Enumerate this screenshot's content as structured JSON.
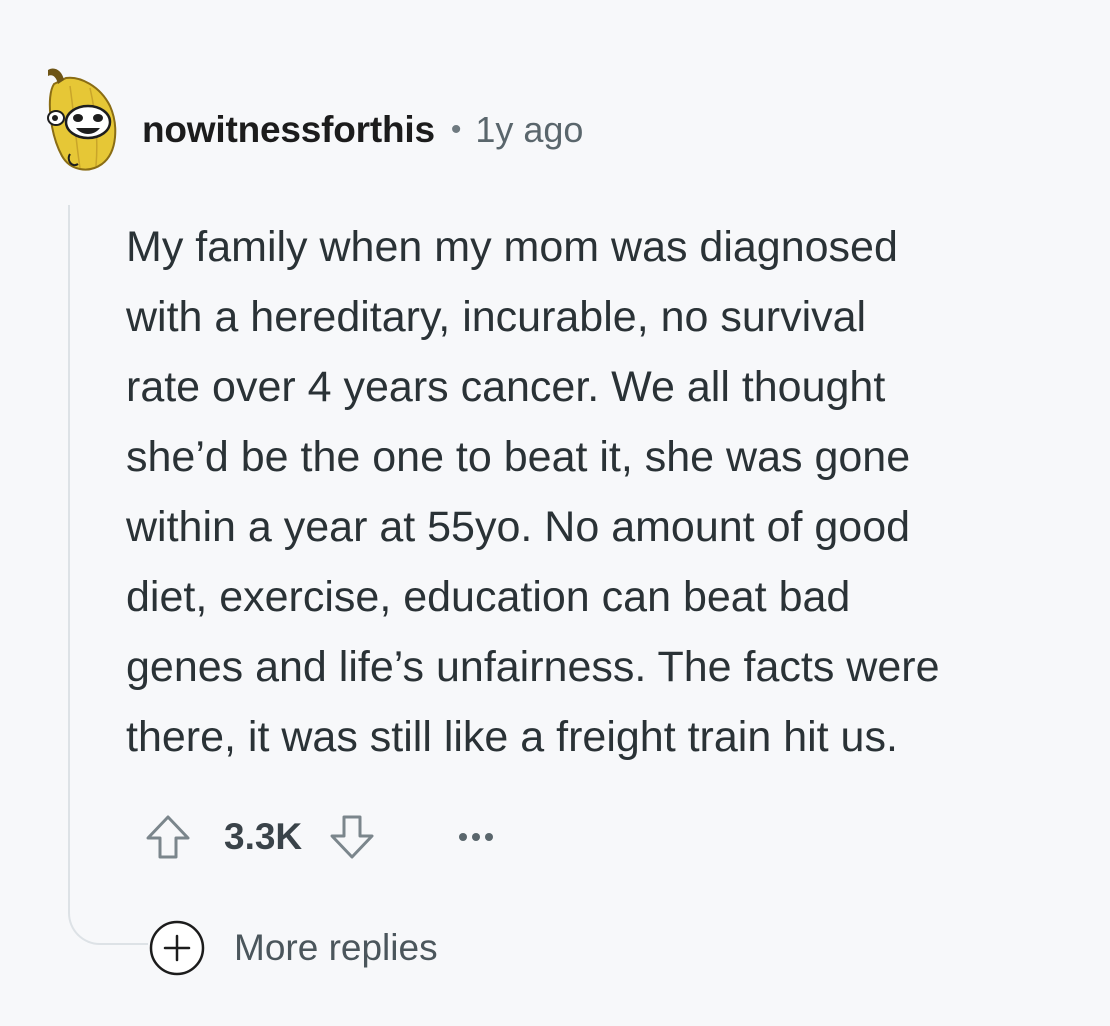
{
  "comment": {
    "author": "nowitnessforthis",
    "separator": "•",
    "timestamp": "1y ago",
    "avatar_icon": "banana-snoo-avatar",
    "body_lines": [
      "My family when my mom was diagnosed",
      "with a hereditary, incurable, no survival",
      "rate over 4 years cancer. We all thought",
      "she’d be the one to beat it, she was gone",
      "within a year at 55yo. No amount of good",
      "diet, exercise, education can beat bad",
      "genes and life’s unfairness. The facts were",
      "there, it was still like a freight train hit us."
    ],
    "score": "3.3K",
    "upvote_icon": "upvote-arrow-icon",
    "downvote_icon": "downvote-arrow-icon",
    "overflow_icon": "more-options-icon",
    "more_replies_label": "More replies",
    "more_replies_icon": "plus-circle-icon"
  },
  "colors": {
    "background": "#f7f8fa",
    "text": "#2a3236",
    "muted": "#5a666c",
    "thread_line": "#dde2e6",
    "avatar_yellow": "#e8c93a"
  }
}
